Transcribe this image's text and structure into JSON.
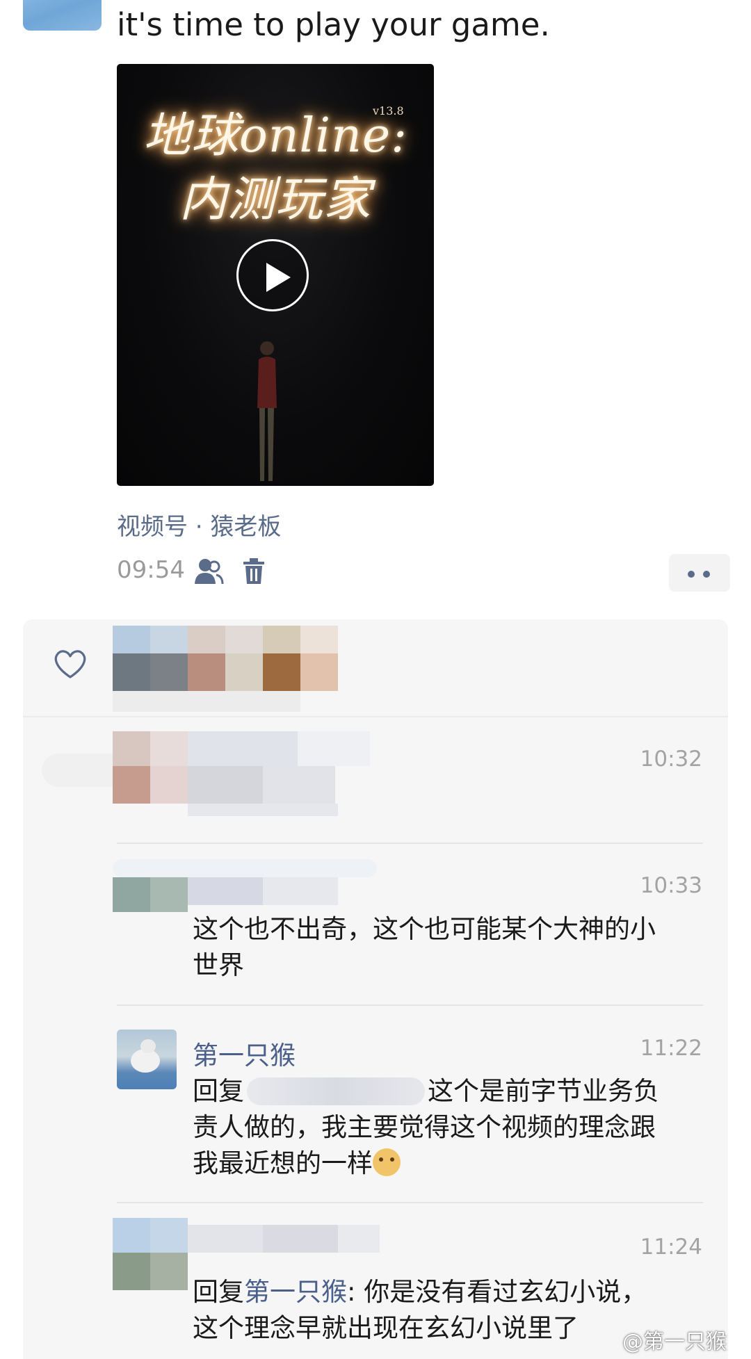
{
  "post": {
    "text": "it's time to play your game.",
    "video": {
      "title_line1": "地球online:",
      "title_line2": "内测玩家",
      "version": "v13.8"
    },
    "source": "视频号 · 猿老板",
    "time": "09:54"
  },
  "icons": [
    "play-icon",
    "people-icon",
    "trash-icon",
    "more-icon",
    "heart-icon"
  ],
  "comments": [
    {
      "time": "10:32",
      "text": ""
    },
    {
      "time": "10:33",
      "text_line1": "这个也不出奇，这个也可能某个大神的小",
      "text_line2": "世界"
    },
    {
      "name": "第一只猴",
      "time": "11:22",
      "reply_prefix": "回复",
      "text_after": "这个是前字节业务负",
      "text_line2": "责人做的，我主要觉得这个视频的理念跟",
      "text_line3": "我最近想的一样"
    },
    {
      "time": "11:24",
      "reply_prefix": "回复",
      "reply_target": "第一只猴",
      "text_line1_rest": ": 你是没有看过玄幻小说，",
      "text_line2": "这个理念早就出现在玄幻小说里了"
    }
  ],
  "watermark": "@第一只猴"
}
